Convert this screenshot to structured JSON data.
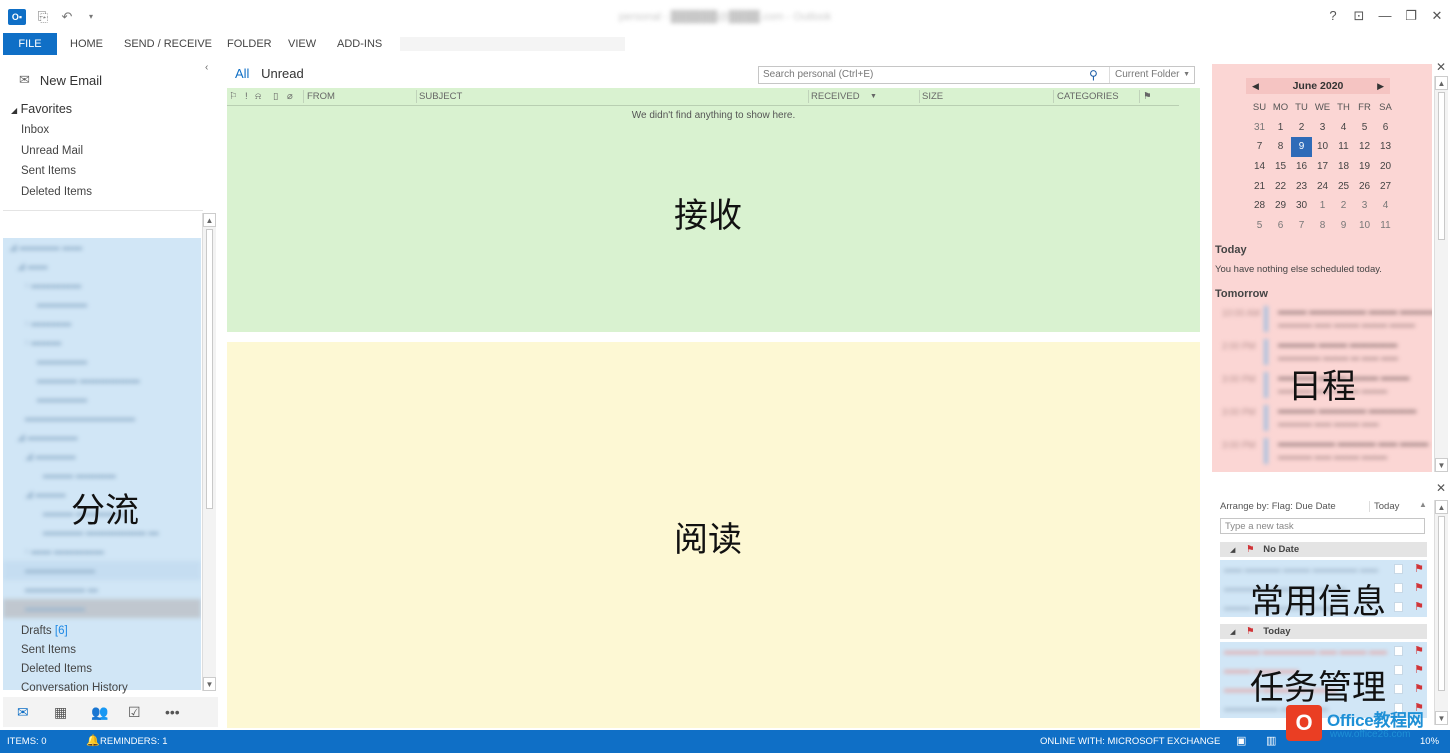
{
  "window": {
    "title": "personal - ██████@████.com - Outlook",
    "controls": [
      "?",
      "⊡",
      "—",
      "❐",
      "✕"
    ]
  },
  "ribbon": {
    "tabs": [
      "FILE",
      "HOME",
      "SEND / RECEIVE",
      "FOLDER",
      "VIEW",
      "ADD-INS"
    ]
  },
  "nav": {
    "new_email": "New Email",
    "favorites_label": "Favorites",
    "favorites": [
      "Inbox",
      "Unread Mail",
      "Sent Items",
      "Deleted Items"
    ],
    "drafts_label": "Drafts",
    "drafts_count": "[6]",
    "bottom_folders": [
      "Sent Items",
      "Deleted Items",
      "Conversation History"
    ],
    "zone_label": "分流"
  },
  "list": {
    "filter_all": "All",
    "filter_unread": "Unread",
    "search_placeholder": "Search personal (Ctrl+E)",
    "search_scope": "Current Folder",
    "columns": {
      "from": "FROM",
      "subject": "SUBJECT",
      "received": "RECEIVED",
      "size": "SIZE",
      "categories": "CATEGORIES"
    },
    "empty_message": "We didn't find anything to show here.",
    "zone_label": "接收"
  },
  "reading": {
    "zone_label": "阅读"
  },
  "calendar": {
    "month": "June 2020",
    "weekdays": [
      "SU",
      "MO",
      "TU",
      "WE",
      "TH",
      "FR",
      "SA"
    ],
    "weeks": [
      [
        "31",
        "1",
        "2",
        "3",
        "4",
        "5",
        "6"
      ],
      [
        "7",
        "8",
        "9",
        "10",
        "11",
        "12",
        "13"
      ],
      [
        "14",
        "15",
        "16",
        "17",
        "18",
        "19",
        "20"
      ],
      [
        "21",
        "22",
        "23",
        "24",
        "25",
        "26",
        "27"
      ],
      [
        "28",
        "29",
        "30",
        "1",
        "2",
        "3",
        "4"
      ],
      [
        "5",
        "6",
        "7",
        "8",
        "9",
        "10",
        "11"
      ]
    ],
    "selected_day": "9",
    "today_label": "Today",
    "today_note": "You have nothing else scheduled today.",
    "tomorrow_label": "Tomorrow",
    "zone_label": "日程"
  },
  "tasks": {
    "arrange_label": "Arrange by: Flag: Due Date",
    "arrange_value": "Today",
    "new_task_placeholder": "Type a new task",
    "group_no_date": "No Date",
    "group_today": "Today",
    "zone_label_1": "常用信息",
    "zone_label_2": "任务管理"
  },
  "status": {
    "items": "ITEMS: 0",
    "reminders": "REMINDERS: 1",
    "connection": "ONLINE WITH: MICROSOFT EXCHANGE",
    "zoom": "10%"
  },
  "watermark": {
    "brand": "Office教程网",
    "site": "www.office26.com"
  },
  "colors": {
    "accent": "#0f6fc6",
    "receive_zone": "#d9f2d0",
    "read_zone": "#fdf8d4",
    "calendar_zone": "#fbd6d4",
    "folder_zone": "#d1e6f6",
    "flag": "#d13438"
  }
}
